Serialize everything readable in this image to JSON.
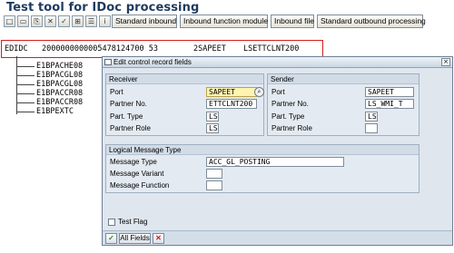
{
  "app": {
    "title": "Test tool for IDoc processing"
  },
  "toolbar": {
    "icons": [
      "new-icon",
      "open-icon",
      "copy-icon",
      "delete-icon",
      "check-icon",
      "tree-icon",
      "list-icon",
      "info-icon"
    ],
    "buttons": [
      "Standard inbound",
      "Inbound function module",
      "Inbound file",
      "Standard outbound processing"
    ]
  },
  "idoc": {
    "control": {
      "segment": "EDIDC",
      "number": "2000000000005478124700 53",
      "sender": "2SAPEET",
      "receiver": "LSETTCLNT200"
    },
    "segments": [
      "E1BPACHE08",
      "E1BPACGL08",
      "E1BPACGL08",
      "E1BPACCR08",
      "E1BPACCR08",
      "E1BPEXTC"
    ]
  },
  "dialog": {
    "title": "Edit control record fields",
    "receiver": {
      "header": "Receiver",
      "port_label": "Port",
      "port_value": "SAPEET",
      "partner_no_label": "Partner No.",
      "partner_no_value": "ETTCLNT200",
      "part_type_label": "Part. Type",
      "part_type_value": "LS",
      "partner_role_label": "Partner Role",
      "partner_role_value": "LS"
    },
    "sender": {
      "header": "Sender",
      "port_label": "Port",
      "port_value": "SAPEET",
      "partner_no_label": "Partner No.",
      "partner_no_value": "LS_WMI_T",
      "part_type_label": "Part. Type",
      "part_type_value": "LS",
      "partner_role_label": "Partner Role",
      "partner_role_value": ""
    },
    "logical_message": {
      "header": "Logical Message Type",
      "message_type_label": "Message Type",
      "message_type_value": "ACC_GL_POSTING",
      "message_variant_label": "Message Variant",
      "message_variant_value": "",
      "message_function_label": "Message Function",
      "message_function_value": ""
    },
    "test_flag_label": "Test Flag",
    "test_flag_checked": false,
    "footer": {
      "all_fields_label": "All Fields"
    }
  },
  "colors": {
    "highlight_border": "#d21f1f",
    "title_color": "#1f3a5f"
  }
}
